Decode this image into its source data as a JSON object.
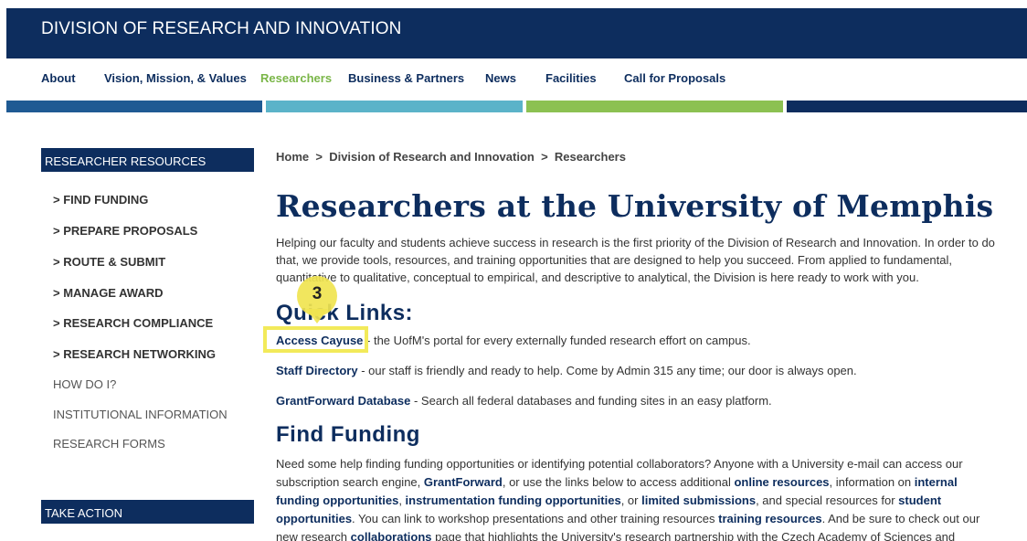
{
  "header": {
    "title": "DIVISION OF RESEARCH AND INNOVATION"
  },
  "nav": {
    "items": [
      {
        "label": "About"
      },
      {
        "label": "Vision, Mission, & Values"
      },
      {
        "label": "Researchers"
      },
      {
        "label": "Business & Partners"
      },
      {
        "label": "News"
      },
      {
        "label": "Facilities"
      },
      {
        "label": "Call for Proposals"
      }
    ],
    "active_color": "#7ab648"
  },
  "stripe_colors": [
    "#1f5a93",
    "#5bb3c9",
    "#8cc152",
    "#0d2d5e"
  ],
  "sidebar": {
    "heading": "RESEARCHER RESOURCES",
    "items": [
      {
        "label": "> FIND FUNDING"
      },
      {
        "label": "> PREPARE PROPOSALS"
      },
      {
        "label": "> ROUTE & SUBMIT"
      },
      {
        "label": "> MANAGE AWARD"
      },
      {
        "label": "> RESEARCH COMPLIANCE"
      },
      {
        "label": "> RESEARCH NETWORKING"
      },
      {
        "label": "HOW DO I?"
      },
      {
        "label": "INSTITUTIONAL INFORMATION"
      },
      {
        "label": "RESEARCH FORMS"
      }
    ],
    "take_action": "TAKE ACTION"
  },
  "breadcrumb": {
    "home": "Home",
    "sep": ">",
    "level2": "Division of Research and Innovation",
    "level3": "Researchers"
  },
  "main": {
    "title": "Researchers at the University of Memphis",
    "intro": "Helping our faculty and students achieve success in research is the first priority of the Division of Research and Innovation. In order to do that, we provide tools, resources, and training opportunities that are designed to help you succeed. From applied to fundamental, quantitative to qualitative, conceptual to empirical, and descriptive to analytical, the Division is here ready to work with you.",
    "quick_links_heading": "Quick Links:",
    "quick_links": [
      {
        "link": "Access Cayuse",
        "text": " - the UofM's portal for every externally funded research effort on campus."
      },
      {
        "link": "Staff Directory",
        "text": " - our staff is friendly and ready to help.  Come by Admin 315 any time; our door is always open."
      },
      {
        "link": "GrantForward Database",
        "text": " - Search all federal databases and funding sites in an easy platform."
      }
    ],
    "find_funding_heading": "Find Funding",
    "find_funding": {
      "t1": "Need some help finding funding opportunities or identifying potential collaborators? Anyone with a University e-mail can access our subscription search engine, ",
      "l1": "GrantForward",
      "t2": ", or use the links below to access additional ",
      "l2": "online resources",
      "t3": ", information on ",
      "l3": "internal funding opportunities",
      "t4": ", ",
      "l4": "instrumentation funding opportunities",
      "t5": ", or ",
      "l5": "limited submissions",
      "t6": ", and special resources for ",
      "l6": "student opportunities",
      "t7": ". You can link to workshop presentations and other training resources ",
      "l7": "training resources",
      "t8": ". And be sure to check out our new research ",
      "l8": "collaborations",
      "t9": " page that highlights the University's research partnership with the Czech Academy of Sciences and provides"
    }
  },
  "annotation": {
    "number": "3",
    "color": "#f2ea5a"
  }
}
